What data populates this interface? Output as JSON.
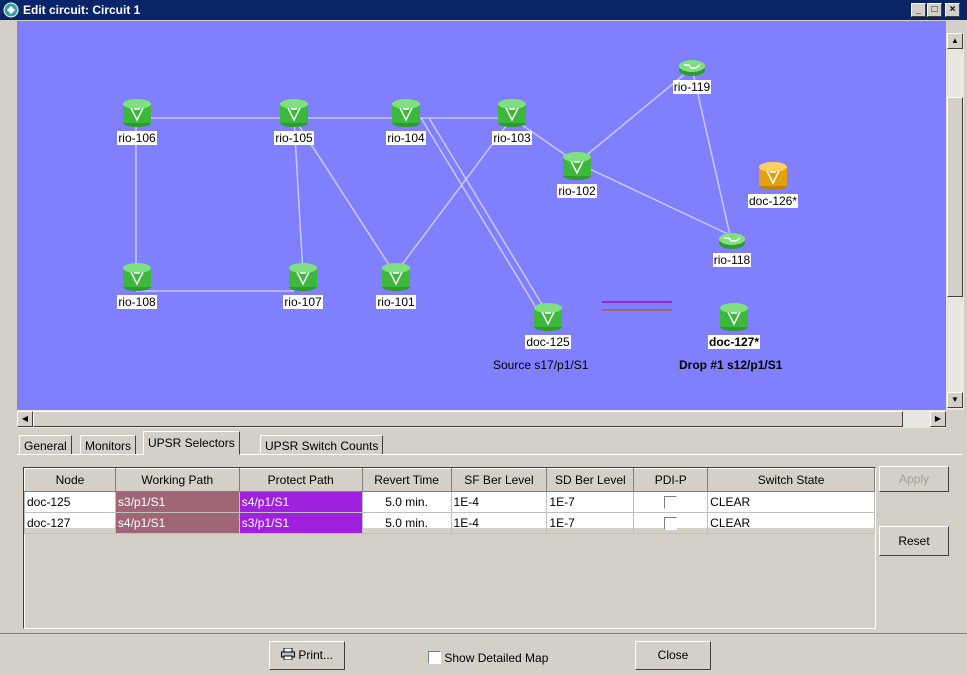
{
  "window": {
    "title": "Edit circuit: Circuit 1"
  },
  "map": {
    "background": "#8080ff",
    "nodes": {
      "rio106": {
        "label": "rio-106"
      },
      "rio105": {
        "label": "rio-105"
      },
      "rio104": {
        "label": "rio-104"
      },
      "rio103": {
        "label": "rio-103"
      },
      "rio102": {
        "label": "rio-102"
      },
      "rio119": {
        "label": "rio-119"
      },
      "doc126": {
        "label": "doc-126*"
      },
      "rio118": {
        "label": "rio-118"
      },
      "rio108": {
        "label": "rio-108"
      },
      "rio107": {
        "label": "rio-107"
      },
      "rio101": {
        "label": "rio-101"
      },
      "doc125": {
        "label": "doc-125",
        "caption": "Source s17/p1/S1"
      },
      "doc127": {
        "label": "doc-127*",
        "caption": "Drop #1 s12/p1/S1"
      }
    }
  },
  "tabs": [
    "General",
    "Monitors",
    "UPSR Selectors",
    "UPSR Switch Counts"
  ],
  "active_tab": "UPSR Selectors",
  "table": {
    "columns": [
      "Node",
      "Working Path",
      "Protect Path",
      "Revert Time",
      "SF Ber Level",
      "SD Ber Level",
      "PDI-P",
      "Switch State"
    ],
    "rows": [
      {
        "node": "doc-125",
        "working": "s3/p1/S1",
        "protect": "s4/p1/S1",
        "revert": "5.0 min.",
        "sf": "1E-4",
        "sd": "1E-7",
        "pdip": false,
        "state": "CLEAR"
      },
      {
        "node": "doc-127",
        "working": "s4/p1/S1",
        "protect": "s3/p1/S1",
        "revert": "5.0 min.",
        "sf": "1E-4",
        "sd": "1E-7",
        "pdip": false,
        "state": "CLEAR"
      }
    ]
  },
  "buttons": {
    "apply": "Apply",
    "reset": "Reset",
    "print": "Print...",
    "close": "Close"
  },
  "show_detailed_map": {
    "label": "Show Detailed Map",
    "checked": false
  },
  "colors": {
    "working_path": "#a06676",
    "protect_path": "#a020e0",
    "title_bar": "#0a246a"
  }
}
